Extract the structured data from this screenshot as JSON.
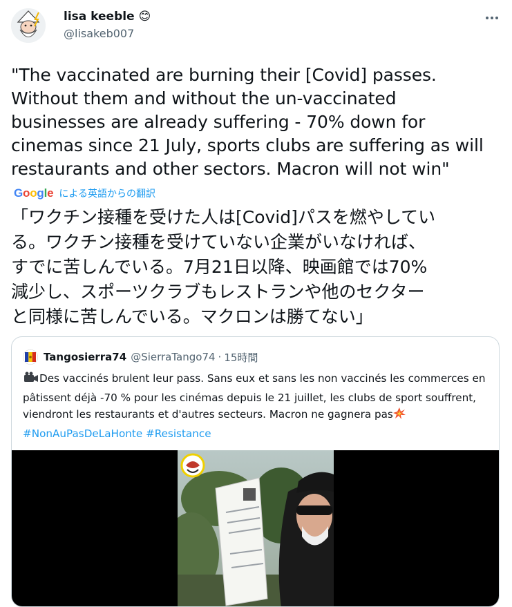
{
  "author": {
    "display_name": "lisa keeble",
    "emoji": "😊",
    "handle": "@lisakeb007"
  },
  "tweet": {
    "text": "\"The vaccinated are burning their [Covid] passes.\nWithout them and without the un-vaccinated\nbusinesses are already suffering - 70% down for\ncinemas since 21 July, sports clubs are suffering as will\nrestaurants and other sectors. Macron will not win\""
  },
  "translation": {
    "google_logo_letters": [
      "G",
      "o",
      "o",
      "g",
      "l",
      "e"
    ],
    "google_logo_colors": [
      "#4285F4",
      "#EA4335",
      "#FBBC05",
      "#4285F4",
      "#34A853",
      "#EA4335"
    ],
    "label": "による英語からの翻訳",
    "text": "「ワクチン接種を受けた人は[Covid]パスを燃やしてい\nる。ワクチン接種を受けていない企業がいなければ、\nすでに苦しんでいる。7月21日以降、映画館では70%\n減少し、スポーツクラブもレストランや他のセクター\nと同様に苦しんでいる。マクロンは勝てない」"
  },
  "quoted_tweet": {
    "display_name": "Tangosierra74",
    "handle": "@SierraTango74",
    "separator": "·",
    "time": "15時間",
    "text_part1": "Des vaccinés brulent leur pass. Sans eux et sans les non vaccinés les commerces en pâtissent déjà -70 % pour les cinémas depuis le 21 juillet, les clubs de sport souffrent, viendront les restaurants et d'autres secteurs. Macron ne gagnera pas",
    "hashtags": "#NonAuPasDeLaHonte #Resistance",
    "leading_icon": "video-camera-icon",
    "trailing_icon": "collision-icon"
  },
  "colors": {
    "link": "#1d9bf0",
    "secondary_text": "#536471",
    "border": "#cfd9de"
  }
}
